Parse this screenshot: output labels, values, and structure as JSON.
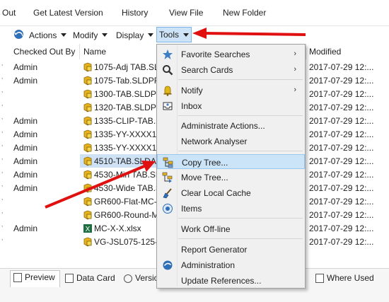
{
  "topbar": {
    "items": [
      "Out",
      "Get Latest Version",
      "History",
      "View File",
      "New Folder"
    ]
  },
  "toolbar": {
    "actions": "Actions",
    "modify": "Modify",
    "display": "Display",
    "tools": "Tools"
  },
  "list": {
    "headers": {
      "checked_out_by": "Checked Out By",
      "name": "Name",
      "modified": "Modified"
    },
    "rows": [
      {
        "owner": "Admin",
        "name": "1075-Adj TAB.SLI",
        "date": "2017-07-29 12:..."
      },
      {
        "owner": "Admin",
        "name": "1075-Tab.SLDPRT",
        "date": "2017-07-29 12:..."
      },
      {
        "owner": "",
        "name": "1300-TAB.SLDPR",
        "date": "2017-07-29 12:..."
      },
      {
        "owner": "",
        "name": "1320-TAB.SLDPR",
        "date": "2017-07-29 12:..."
      },
      {
        "owner": "Admin",
        "name": "1335-CLIP-TAB.S",
        "date": "2017-07-29 12:..."
      },
      {
        "owner": "Admin",
        "name": "1335-YY-XXXX1.s",
        "date": "2017-07-29 12:..."
      },
      {
        "owner": "Admin",
        "name": "1335-YY-XXXX1.s",
        "date": "2017-07-29 12:..."
      },
      {
        "owner": "Admin",
        "name": "4510-TAB.SLDAS",
        "date": "2017-07-29 12:..."
      },
      {
        "owner": "Admin",
        "name": "4530-Min TAB.SL",
        "date": "2017-07-29 12:..."
      },
      {
        "owner": "Admin",
        "name": "4530-Wide TAB.S",
        "date": "2017-07-29 12:..."
      },
      {
        "owner": "",
        "name": "GR600-Flat-MC-",
        "date": "2017-07-29 12:..."
      },
      {
        "owner": "",
        "name": "GR600-Round-M",
        "date": "2017-07-29 12:..."
      },
      {
        "owner": "Admin",
        "name": "MC-X-X.xlsx",
        "date": "2017-07-29 12:..."
      },
      {
        "owner": "",
        "name": "VG-JSL075-125-1",
        "date": "2017-07-29 12:..."
      }
    ]
  },
  "menu": {
    "items": [
      {
        "label": "Favorite Searches",
        "icon": "star-icon",
        "submenu": true
      },
      {
        "label": "Search Cards",
        "icon": "magnifier-icon",
        "submenu": true
      },
      {
        "label": "Notify",
        "icon": "bell-icon",
        "submenu": true
      },
      {
        "label": "Inbox",
        "icon": "inbox-icon",
        "submenu": false
      },
      {
        "label": "Administrate Actions...",
        "icon": "",
        "submenu": false
      },
      {
        "label": "Network Analyser",
        "icon": "",
        "submenu": false
      },
      {
        "label": "Copy Tree...",
        "icon": "copy-tree-icon",
        "submenu": false
      },
      {
        "label": "Move Tree...",
        "icon": "move-tree-icon",
        "submenu": false
      },
      {
        "label": "Clear Local Cache",
        "icon": "broom-icon",
        "submenu": false
      },
      {
        "label": "Items",
        "icon": "items-icon",
        "submenu": false
      },
      {
        "label": "Work Off-line",
        "icon": "",
        "submenu": false
      },
      {
        "label": "Report Generator",
        "icon": "",
        "submenu": false
      },
      {
        "label": "Administration",
        "icon": "admin-icon",
        "submenu": false
      },
      {
        "label": "Update References...",
        "icon": "",
        "submenu": false
      }
    ],
    "highlighted": "Copy Tree...",
    "submenu_glyph": "›"
  },
  "bottom_tabs": {
    "preview": "Preview",
    "data_card": "Data Card",
    "version": "Versio",
    "where_used": "Where Used"
  },
  "colors": {
    "highlight": "#cce4f7",
    "arrow": "#e01010",
    "selection": "#cfe1f5"
  }
}
